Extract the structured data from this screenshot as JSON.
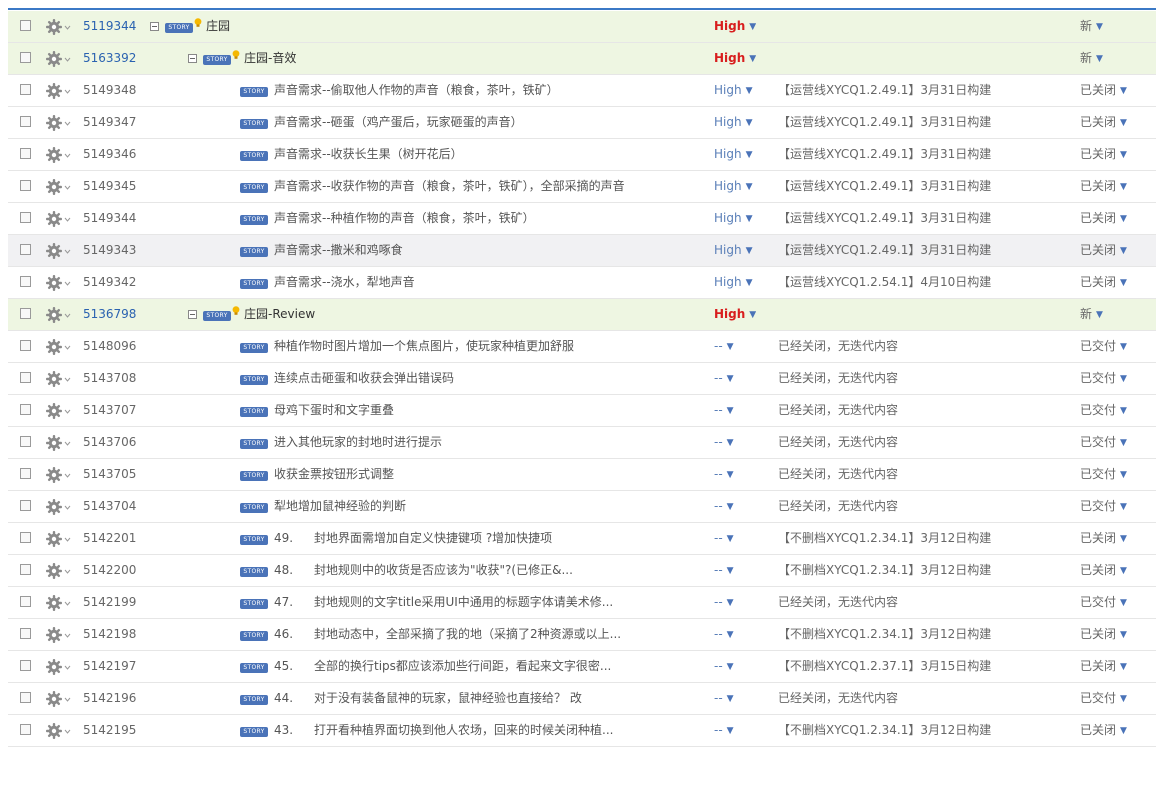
{
  "colors": {
    "group_row_bg": "#eef6e2",
    "high_priority": "#d81e1e",
    "link_blue": "#2a62b0",
    "story_badge": "#4a73b8"
  },
  "icons": {
    "checkbox": "checkbox-icon",
    "settings": "gear-icon",
    "collapse": "collapse-icon",
    "story": "story-badge-icon"
  },
  "story_badge": "STORY",
  "rows": [
    {
      "id": "5119344",
      "title": "庄园",
      "priority": "High",
      "iteration": "",
      "status": "新",
      "group": true,
      "level": 0
    },
    {
      "id": "5163392",
      "title": "庄园-音效",
      "priority": "High",
      "iteration": "",
      "status": "新",
      "group": true,
      "level": 1
    },
    {
      "id": "5149348",
      "title": "声音需求--偷取他人作物的声音（粮食，茶叶，铁矿）",
      "priority": "High",
      "iteration": "【运营线XYCQ1.2.49.1】3月31日构建",
      "status": "已关闭"
    },
    {
      "id": "5149347",
      "title": "声音需求--砸蛋（鸡产蛋后，玩家砸蛋的声音）",
      "priority": "High",
      "iteration": "【运营线XYCQ1.2.49.1】3月31日构建",
      "status": "已关闭"
    },
    {
      "id": "5149346",
      "title": "声音需求--收获长生果（树开花后）",
      "priority": "High",
      "iteration": "【运营线XYCQ1.2.49.1】3月31日构建",
      "status": "已关闭"
    },
    {
      "id": "5149345",
      "title": "声音需求--收获作物的声音（粮食，茶叶，铁矿），全部采摘的声音",
      "priority": "High",
      "iteration": "【运营线XYCQ1.2.49.1】3月31日构建",
      "status": "已关闭"
    },
    {
      "id": "5149344",
      "title": "声音需求--种植作物的声音（粮食，茶叶，铁矿）",
      "priority": "High",
      "iteration": "【运营线XYCQ1.2.49.1】3月31日构建",
      "status": "已关闭"
    },
    {
      "id": "5149343",
      "title": "声音需求--撒米和鸡啄食",
      "priority": "High",
      "iteration": "【运营线XYCQ1.2.49.1】3月31日构建",
      "status": "已关闭",
      "highlight": true
    },
    {
      "id": "5149342",
      "title": "声音需求--浇水，犁地声音",
      "priority": "High",
      "iteration": "【运营线XYCQ1.2.54.1】4月10日构建",
      "status": "已关闭"
    },
    {
      "id": "5136798",
      "title": "庄园-Review",
      "priority": "High",
      "iteration": "",
      "status": "新",
      "group": true,
      "level": 1
    },
    {
      "id": "5148096",
      "title": "种植作物时图片增加一个焦点图片，使玩家种植更加舒服",
      "priority": "--",
      "iteration": "已经关闭，无迭代内容",
      "status": "已交付"
    },
    {
      "id": "5143708",
      "title": "连续点击砸蛋和收获会弹出错误码",
      "priority": "--",
      "iteration": "已经关闭，无迭代内容",
      "status": "已交付"
    },
    {
      "id": "5143707",
      "title": "母鸡下蛋时和文字重叠",
      "priority": "--",
      "iteration": "已经关闭，无迭代内容",
      "status": "已交付"
    },
    {
      "id": "5143706",
      "title": "进入其他玩家的封地时进行提示",
      "priority": "--",
      "iteration": "已经关闭，无迭代内容",
      "status": "已交付"
    },
    {
      "id": "5143705",
      "title": "收获金票按钮形式调整",
      "priority": "--",
      "iteration": "已经关闭，无迭代内容",
      "status": "已交付"
    },
    {
      "id": "5143704",
      "title": "犁地增加鼠神经验的判断",
      "priority": "--",
      "iteration": "已经关闭，无迭代内容",
      "status": "已交付"
    },
    {
      "id": "5142201",
      "num": "49.",
      "title": "封地界面需增加自定义快捷键项 ?增加快捷项",
      "priority": "--",
      "iteration": "【不删档XYCQ1.2.34.1】3月12日构建",
      "status": "已关闭"
    },
    {
      "id": "5142200",
      "num": "48.",
      "title": "封地规则中的收货是否应该为\"收获\"?(已修正&...",
      "priority": "--",
      "iteration": "【不删档XYCQ1.2.34.1】3月12日构建",
      "status": "已关闭"
    },
    {
      "id": "5142199",
      "num": "47.",
      "title": "封地规则的文字title采用UI中通用的标题字体请美术修...",
      "priority": "--",
      "iteration": "已经关闭，无迭代内容",
      "status": "已交付"
    },
    {
      "id": "5142198",
      "num": "46.",
      "title": "封地动态中，全部采摘了我的地（采摘了2种资源或以上...",
      "priority": "--",
      "iteration": "【不删档XYCQ1.2.34.1】3月12日构建",
      "status": "已关闭"
    },
    {
      "id": "5142197",
      "num": "45.",
      "title": "全部的换行tips都应该添加些行间距，看起来文字很密...",
      "priority": "--",
      "iteration": "【不删档XYCQ1.2.37.1】3月15日构建",
      "status": "已关闭"
    },
    {
      "id": "5142196",
      "num": "44.",
      "title": "对于没有装备鼠神的玩家，鼠神经验也直接给？ 改",
      "priority": "--",
      "iteration": "已经关闭，无迭代内容",
      "status": "已交付"
    },
    {
      "id": "5142195",
      "num": "43.",
      "title": "打开看种植界面切换到他人农场，回来的时候关闭种植...",
      "priority": "--",
      "iteration": "【不删档XYCQ1.2.34.1】3月12日构建",
      "status": "已关闭"
    }
  ]
}
